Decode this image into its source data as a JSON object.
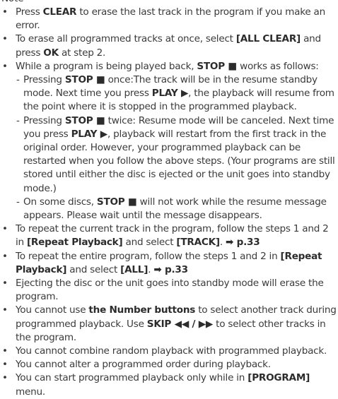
{
  "heading": "Note",
  "notes": [
    {
      "parts": [
        {
          "t": "Press "
        },
        {
          "b": "CLEAR"
        },
        {
          "t": " to erase the last track in the program if you make an error."
        }
      ]
    },
    {
      "parts": [
        {
          "t": "To erase all programmed tracks at once, select "
        },
        {
          "b": "[ALL CLEAR]"
        },
        {
          "t": " and press "
        },
        {
          "b": "OK"
        },
        {
          "t": " at step 2."
        }
      ]
    },
    {
      "parts": [
        {
          "t": "While a program is being played back, "
        },
        {
          "b": "STOP ■"
        },
        {
          "t": " works as follows:"
        }
      ],
      "sub": [
        {
          "parts": [
            {
              "t": "Pressing "
            },
            {
              "b": "STOP ■"
            },
            {
              "t": " once:The track will be in the resume standby mode. Next time you press "
            },
            {
              "b": "PLAY ▶"
            },
            {
              "t": ", the playback will resume from the point where it is stopped in the programmed playback."
            }
          ]
        },
        {
          "parts": [
            {
              "t": "Pressing "
            },
            {
              "b": "STOP ■"
            },
            {
              "t": " twice: Resume mode will be canceled. Next time you press "
            },
            {
              "b": "PLAY ▶"
            },
            {
              "t": ", playback will restart from the first track in the original order. However, your programmed playback can be restarted when you follow the above steps. (Your programs are still stored until either the disc is ejected or the unit goes into standby mode.)"
            }
          ]
        },
        {
          "parts": [
            {
              "t": "On some discs, "
            },
            {
              "b": "STOP ■"
            },
            {
              "t": " will not work while the resume message appears. Please wait until the message disappears."
            }
          ]
        }
      ]
    },
    {
      "parts": [
        {
          "t": "To repeat the current track in the program, follow the steps 1 and 2 in "
        },
        {
          "b": "[Repeat Playback]"
        },
        {
          "t": " and select "
        },
        {
          "b": "[TRACK]"
        },
        {
          "t": ". "
        },
        {
          "r": "➡ p.33"
        }
      ]
    },
    {
      "parts": [
        {
          "t": "To repeat the entire program, follow the steps 1 and 2 in "
        },
        {
          "b": "[Repeat Playback]"
        },
        {
          "t": " and select "
        },
        {
          "b": "[ALL]"
        },
        {
          "t": ". "
        },
        {
          "r": "➡ p.33"
        }
      ]
    },
    {
      "parts": [
        {
          "t": "Ejecting the disc or the unit goes into standby mode will erase the program."
        }
      ]
    },
    {
      "parts": [
        {
          "t": "You cannot use "
        },
        {
          "b": "the Number buttons"
        },
        {
          "t": " to select another track during programmed playback. Use "
        },
        {
          "b": "SKIP ◀◀ / ▶▶"
        },
        {
          "t": " to select other tracks in the program."
        }
      ]
    },
    {
      "parts": [
        {
          "t": "You cannot combine random playback with programmed playback."
        }
      ]
    },
    {
      "parts": [
        {
          "t": "You cannot alter a programmed order during playback."
        }
      ]
    },
    {
      "parts": [
        {
          "t": "You can start programmed playback only while in "
        },
        {
          "b": "[PROGRAM]"
        },
        {
          "t": " menu."
        }
      ]
    }
  ]
}
